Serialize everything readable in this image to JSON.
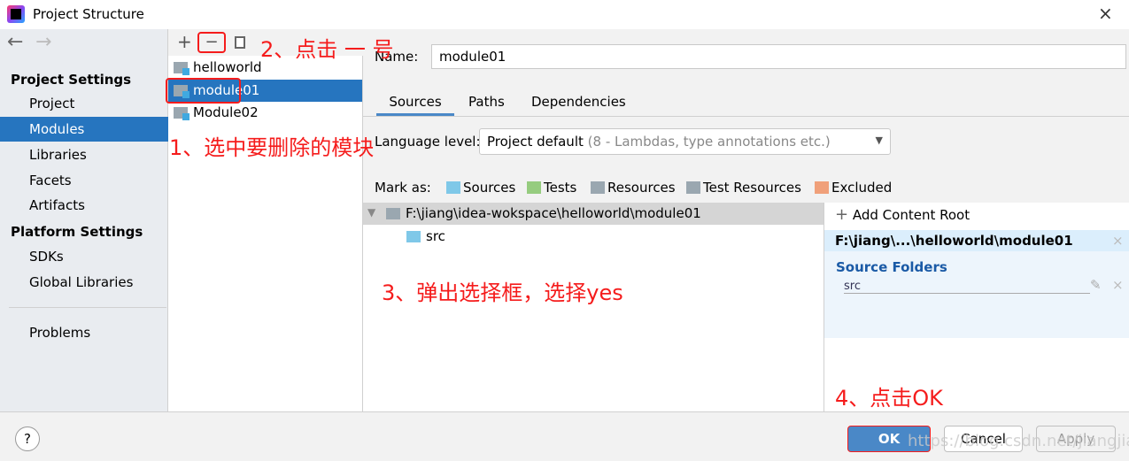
{
  "window": {
    "title": "Project Structure",
    "icon": "intellij-logo",
    "close": "×"
  },
  "sidebar": {
    "back": "←",
    "forward": "→",
    "project_settings": "Project Settings",
    "items1": [
      "Project",
      "Modules",
      "Libraries",
      "Facets",
      "Artifacts"
    ],
    "platform_settings": "Platform Settings",
    "items2": [
      "SDKs",
      "Global Libraries"
    ],
    "problems": "Problems",
    "selected": "Modules"
  },
  "modules": {
    "toolbar": {
      "add": "+",
      "remove": "−",
      "copy": "copy-icon"
    },
    "items": [
      "helloworld",
      "module01",
      "Module02"
    ],
    "selected": "module01"
  },
  "main": {
    "name_label": "Name:",
    "name_value": "module01",
    "tabs": [
      "Sources",
      "Paths",
      "Dependencies"
    ],
    "active_tab": "Sources",
    "language_label": "Language level:",
    "language_value": "Project default",
    "language_hint": "(8 - Lambdas, type annotations etc.)",
    "mark_as": "Mark as:",
    "marks": [
      {
        "label": "Sources",
        "color": "#7fc8e8"
      },
      {
        "label": "Tests",
        "color": "#96cc7f"
      },
      {
        "label": "Resources",
        "color": "#9aa7b0"
      },
      {
        "label": "Test Resources",
        "color": "#9aa7b0"
      },
      {
        "label": "Excluded",
        "color": "#f0a07a"
      }
    ],
    "tree_root": "F:\\jiang\\idea-wokspace\\helloworld\\module01",
    "tree_child": "src",
    "add_content_root": "Add Content Root",
    "content_root": "F:\\jiang\\...\\helloworld\\module01",
    "source_folders": "Source Folders",
    "source_folder": "src"
  },
  "annotations": {
    "a1": "1、选中要删除的模块",
    "a2": "2、点击 一 号",
    "a3": "3、弹出选择框，选择yes",
    "a4": "4、点击OK"
  },
  "footer": {
    "help": "?",
    "ok": "OK",
    "cancel": "Cancel",
    "apply": "Apply",
    "watermark": "https://blog.csdn.net/jiangjiaoyong"
  },
  "colors": {
    "accent": "#2675bf",
    "annotation": "#f51c1c"
  }
}
